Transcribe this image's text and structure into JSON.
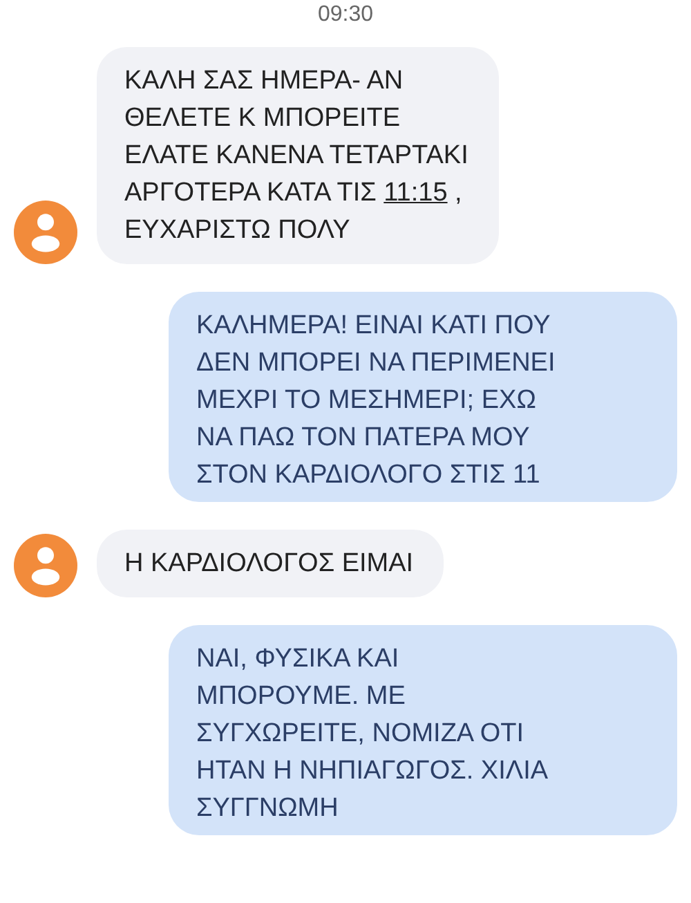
{
  "time": "09:30",
  "messages": [
    {
      "kind": "incoming",
      "parts": [
        {
          "text": "ΚΑΛΗ ΣΑΣ ΗΜΕΡΑ- ΑΝ\nΘΕΛΕΤΕ Κ ΜΠΟΡΕΙΤΕ\nΕΛΑΤΕ ΚΑΝΕΝΑ ΤΕΤΑΡΤΑΚΙ\nΑΡΓΟΤΕΡΑ ΚΑΤΑ ΤΙΣ "
        },
        {
          "text": "11:15",
          "kind": "link"
        },
        {
          "text": " ,\nΕΥΧΑΡΙΣΤΩ ΠΟΛΥ"
        }
      ]
    },
    {
      "kind": "outgoing",
      "parts": [
        {
          "text": "ΚΑΛΗΜΕΡΑ! ΕΙΝΑΙ ΚΑΤΙ ΠΟΥ\nΔΕΝ ΜΠΟΡΕΙ ΝΑ ΠΕΡΙΜΕΝΕΙ\nΜΕΧΡΙ ΤΟ ΜΕΣΗΜΕΡΙ; ΕΧΩ\nΝΑ ΠΑΩ ΤΟΝ ΠΑΤΕΡΑ ΜΟΥ\nΣΤΟΝ ΚΑΡΔΙΟΛΟΓΟ ΣΤΙΣ 11"
        }
      ]
    },
    {
      "kind": "incoming",
      "parts": [
        {
          "text": "Η ΚΑΡΔΙΟΛΟΓΟΣ ΕΙΜΑΙ"
        }
      ]
    },
    {
      "kind": "outgoing",
      "parts": [
        {
          "text": "ΝΑΙ, ΦΥΣΙΚΑ ΚΑΙ\nΜΠΟΡΟΥΜΕ. ΜΕ\nΣΥΓΧΩΡΕΙΤΕ, ΝΟΜΙΖΑ ΟΤΙ\nΗΤΑΝ Η ΝΗΠΙΑΓΩΓΟΣ. ΧΙΛΙΑ\nΣΥΓΓΝΩΜΗ"
        }
      ]
    }
  ]
}
